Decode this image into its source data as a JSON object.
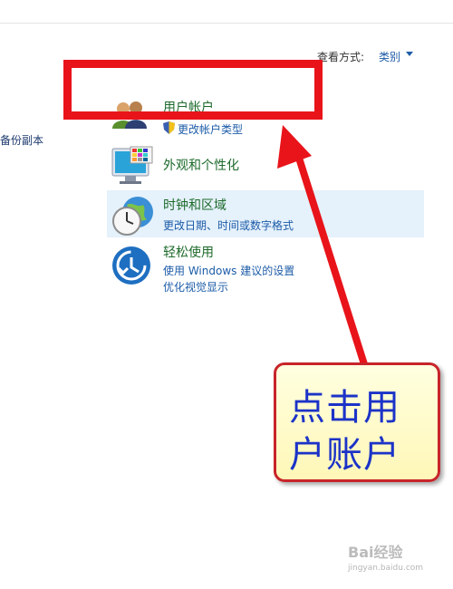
{
  "view_by": {
    "label": "查看方式:",
    "selected": "类别"
  },
  "sidebar": {
    "link_fragment": "备份副本"
  },
  "categories": {
    "users": {
      "title": "用户帐户",
      "sub": "更改帐户类型"
    },
    "appearance": {
      "title": "外观和个性化"
    },
    "clock": {
      "title": "时钟和区域",
      "sub": "更改日期、时间或数字格式"
    },
    "ease": {
      "title": "轻松使用",
      "sub1": "使用 Windows 建议的设置",
      "sub2": "优化视觉显示"
    }
  },
  "callout": {
    "line1": "点击用",
    "line2": "户账户"
  },
  "watermark": {
    "logo": "Bai经验",
    "url": "jingyan.baidu.com"
  },
  "colors": {
    "highlight": "#e8141a",
    "callout_text": "#1c33c8",
    "link_blue": "#1d5ca8",
    "title_green": "#1d6a2b"
  }
}
